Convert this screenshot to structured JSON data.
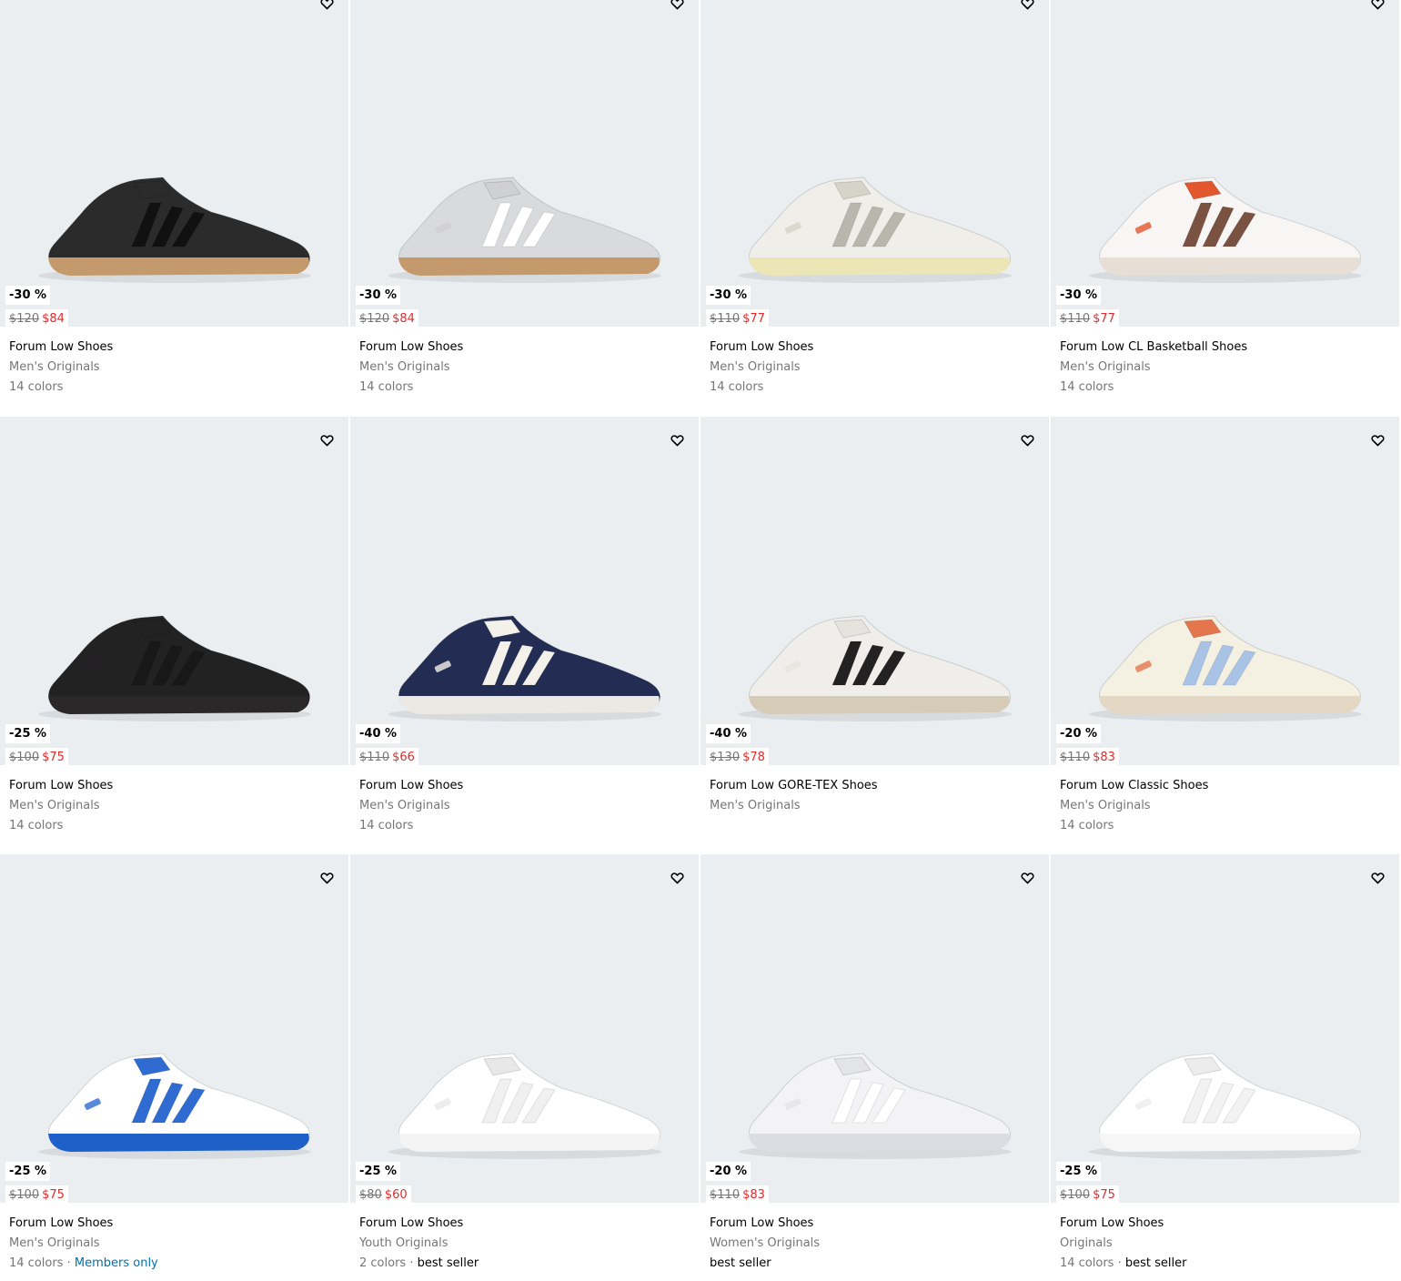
{
  "products": [
    {
      "discount": "-30 %",
      "old_price": "$120",
      "new_price": "$84",
      "title": "Forum Low Shoes",
      "category": "Men's Originals",
      "colors": "14 colors",
      "tag": "",
      "tag_type": "",
      "shoe": {
        "upper": "#2b2b2b",
        "stripes": "#111111",
        "sole": "#c49a6c",
        "accent": "#2b2b2b"
      }
    },
    {
      "discount": "-30 %",
      "old_price": "$120",
      "new_price": "$84",
      "title": "Forum Low Shoes",
      "category": "Men's Originals",
      "colors": "14 colors",
      "tag": "",
      "tag_type": "",
      "shoe": {
        "upper": "#d9dadc",
        "stripes": "#ffffff",
        "sole": "#c49a6c",
        "accent": "#cfd0d2"
      }
    },
    {
      "discount": "-30 %",
      "old_price": "$110",
      "new_price": "$77",
      "title": "Forum Low Shoes",
      "category": "Men's Originals",
      "colors": "14 colors",
      "tag": "",
      "tag_type": "",
      "shoe": {
        "upper": "#efeee9",
        "stripes": "#b9b6ad",
        "sole": "#ece5b6",
        "accent": "#d6d3c8"
      }
    },
    {
      "discount": "-30 %",
      "old_price": "$110",
      "new_price": "$77",
      "title": "Forum Low CL Basketball Shoes",
      "category": "Men's Originals",
      "colors": "14 colors",
      "tag": "",
      "tag_type": "",
      "shoe": {
        "upper": "#f7f6f4",
        "stripes": "#7a5242",
        "sole": "#e7dfd6",
        "accent": "#e2572e"
      }
    },
    {
      "discount": "-25 %",
      "old_price": "$100",
      "new_price": "$75",
      "title": "Forum Low Shoes",
      "category": "Men's Originals",
      "colors": "14 colors",
      "tag": "",
      "tag_type": "",
      "shoe": {
        "upper": "#232223",
        "stripes": "#181818",
        "sole": "#2a2829",
        "accent": "#232223"
      }
    },
    {
      "discount": "-40 %",
      "old_price": "$110",
      "new_price": "$66",
      "title": "Forum Low Shoes",
      "category": "Men's Originals",
      "colors": "14 colors",
      "tag": "",
      "tag_type": "",
      "shoe": {
        "upper": "#232c53",
        "stripes": "#f3f1ea",
        "sole": "#ece9e4",
        "accent": "#f3f1ea"
      }
    },
    {
      "discount": "-40 %",
      "old_price": "$130",
      "new_price": "$78",
      "title": "Forum Low GORE-TEX Shoes",
      "category": "Men's Originals",
      "colors": "",
      "tag": "",
      "tag_type": "",
      "shoe": {
        "upper": "#efeeea",
        "stripes": "#222222",
        "sole": "#d6cbb7",
        "accent": "#e5e3dd"
      }
    },
    {
      "discount": "-20 %",
      "old_price": "$110",
      "new_price": "$83",
      "title": "Forum Low Classic Shoes",
      "category": "Men's Originals",
      "colors": "14 colors",
      "tag": "",
      "tag_type": "",
      "shoe": {
        "upper": "#f4f0e2",
        "stripes": "#a9c3e6",
        "sole": "#e4d8c4",
        "accent": "#e5754d"
      }
    },
    {
      "discount": "-25 %",
      "old_price": "$100",
      "new_price": "$75",
      "title": "Forum Low Shoes",
      "category": "Men's Originals",
      "colors": "14 colors",
      "tag": "Members only",
      "tag_type": "member",
      "shoe": {
        "upper": "#ffffff",
        "stripes": "#2f6bd1",
        "sole": "#1f5fc8",
        "accent": "#2f6bd1"
      }
    },
    {
      "discount": "-25 %",
      "old_price": "$80",
      "new_price": "$60",
      "title": "Forum Low Shoes",
      "category": "Youth Originals",
      "colors": "2 colors",
      "tag": "best seller",
      "tag_type": "best",
      "shoe": {
        "upper": "#ffffff",
        "stripes": "#f0f0f0",
        "sole": "#f4f4f4",
        "accent": "#e8e8e8"
      }
    },
    {
      "discount": "-20 %",
      "old_price": "$110",
      "new_price": "$83",
      "title": "Forum Low Shoes",
      "category": "Women's Originals",
      "colors": "",
      "tag": "best seller",
      "tag_type": "best",
      "shoe": {
        "upper": "#f3f3f5",
        "stripes": "#ffffff",
        "sole": "#dcdde2",
        "accent": "#e3e4e8"
      }
    },
    {
      "discount": "-25 %",
      "old_price": "$100",
      "new_price": "$75",
      "title": "Forum Low Shoes",
      "category": "Originals",
      "colors": "14 colors",
      "tag": "best seller",
      "tag_type": "best",
      "shoe": {
        "upper": "#ffffff",
        "stripes": "#f2f2f2",
        "sole": "#f6f6f6",
        "accent": "#ececec"
      }
    }
  ]
}
